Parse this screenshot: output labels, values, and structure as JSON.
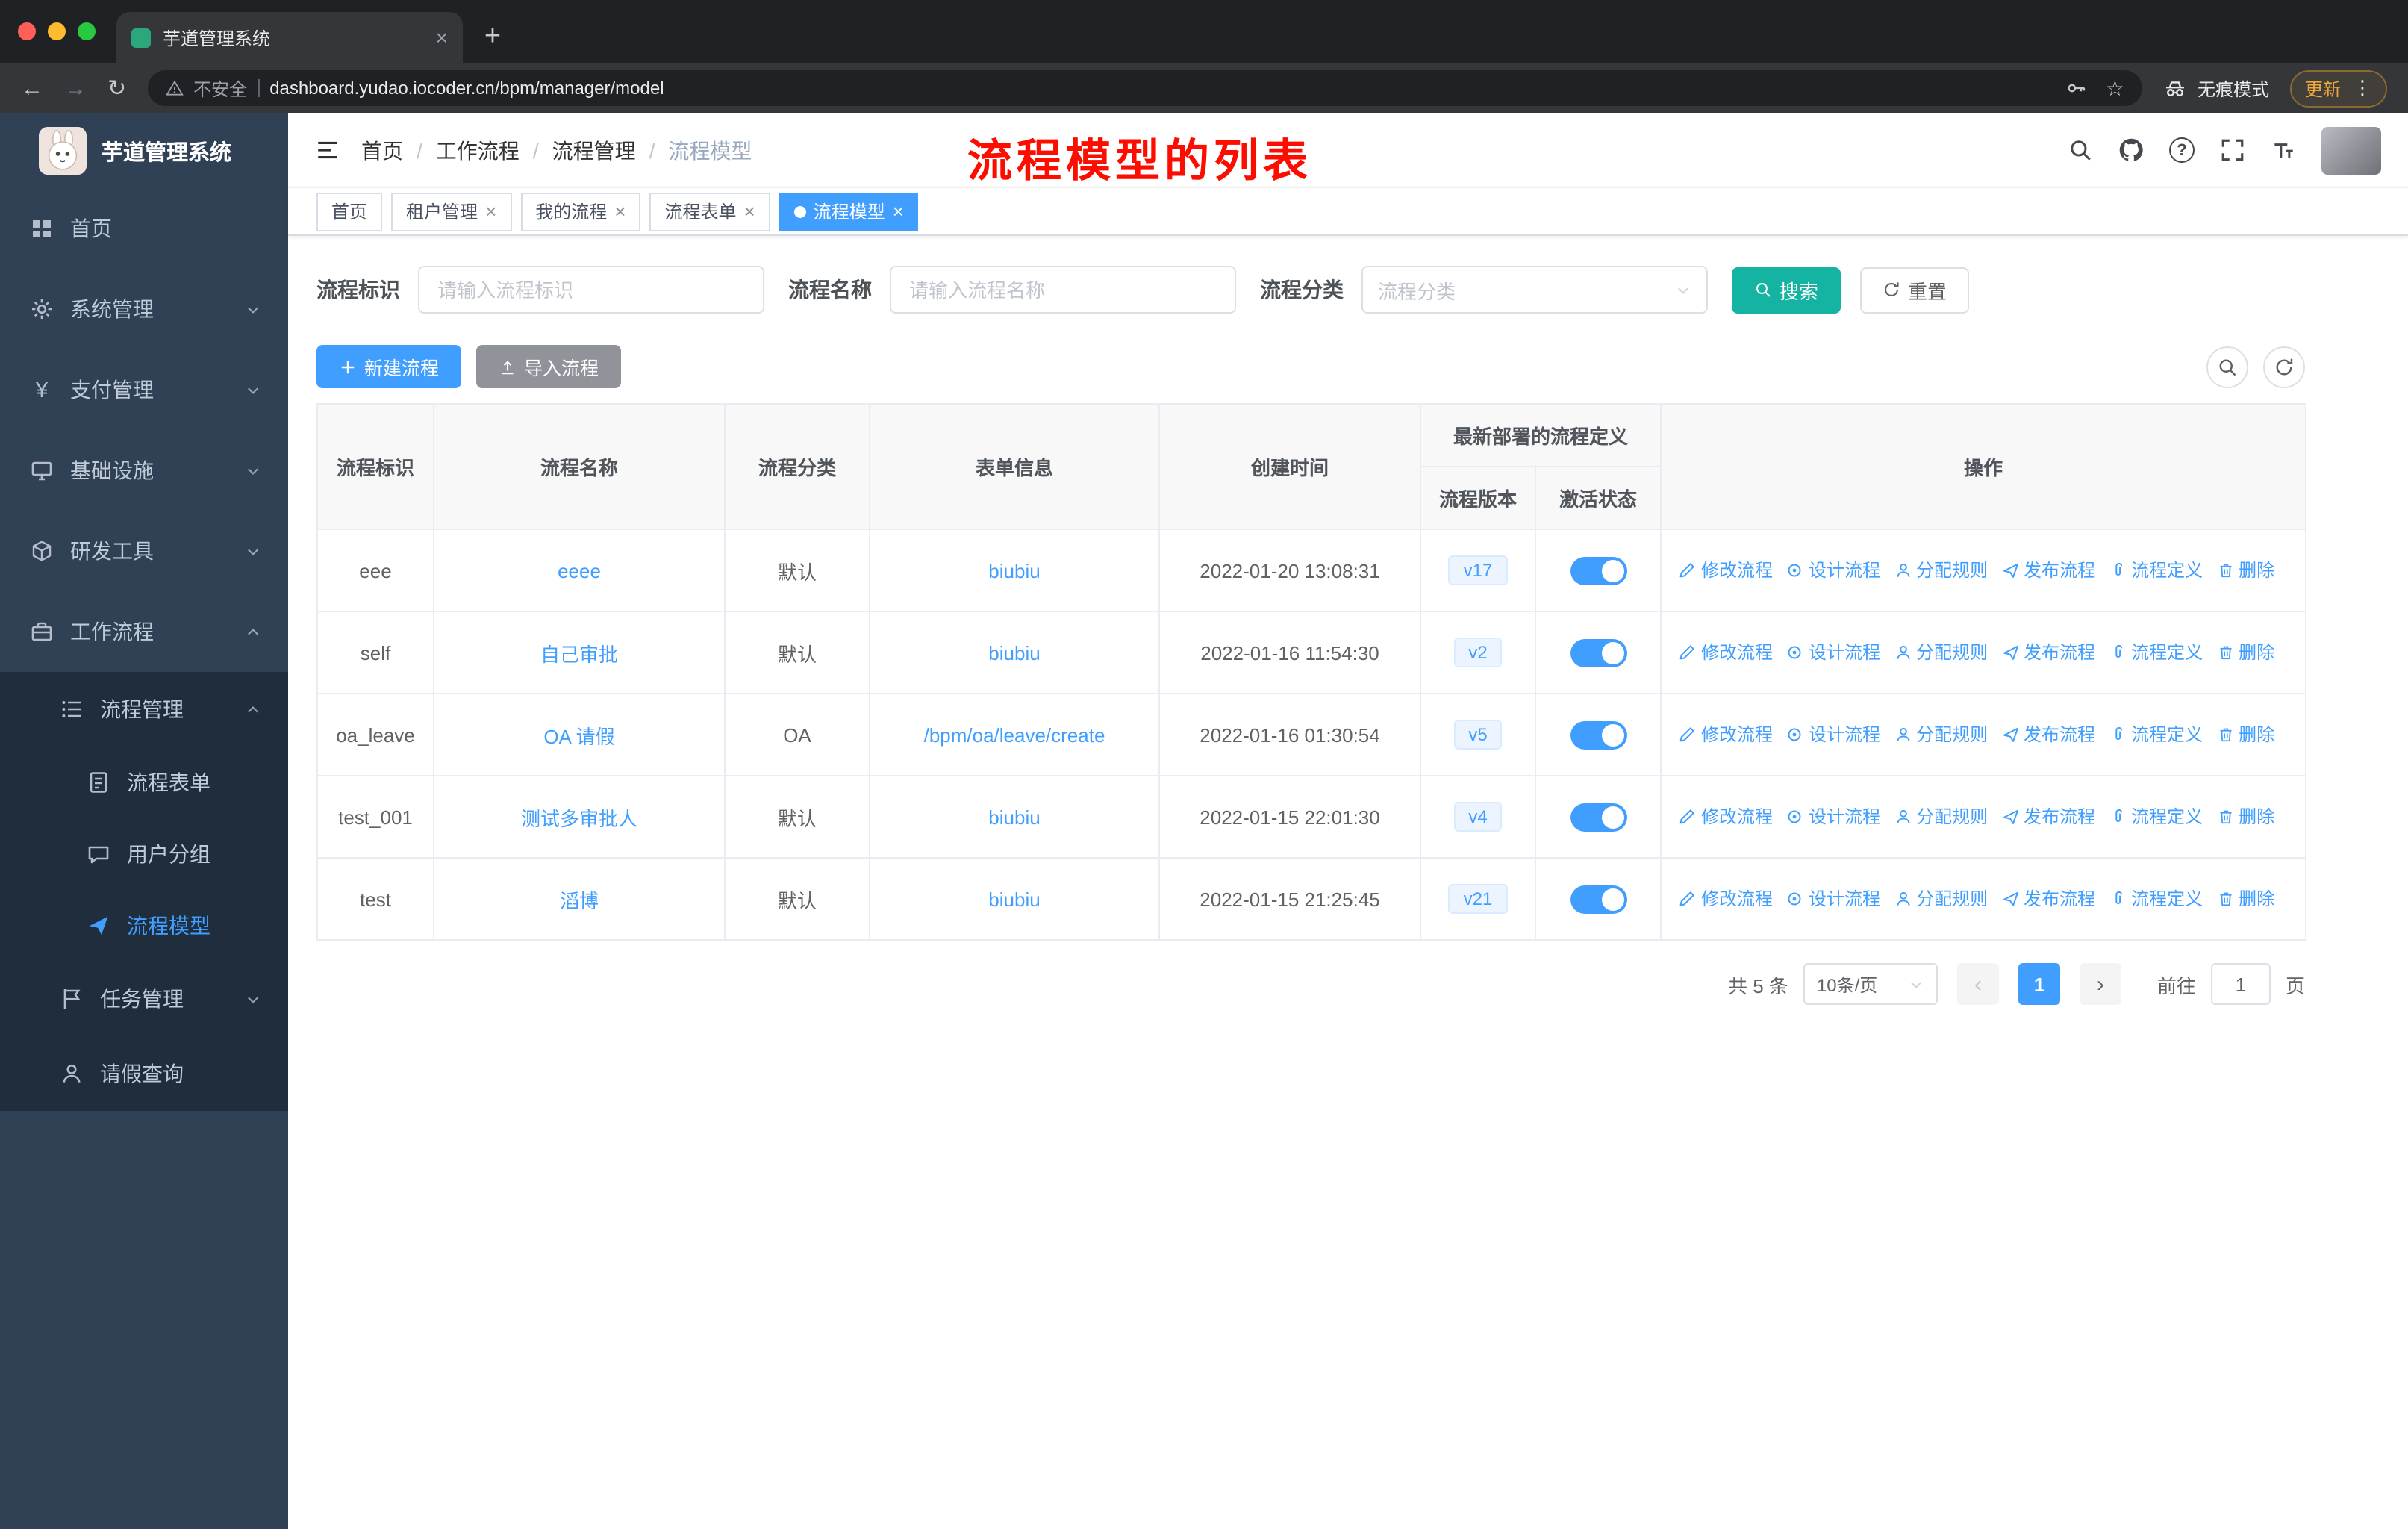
{
  "browser": {
    "tab_title": "芋道管理系统",
    "security_label": "不安全",
    "url": "dashboard.yudao.iocoder.cn/bpm/manager/model",
    "incognito_label": "无痕模式",
    "update_label": "更新"
  },
  "sidebar": {
    "logo_title": "芋道管理系统",
    "items": [
      {
        "label": "首页",
        "icon": "dashboard-icon"
      },
      {
        "label": "系统管理",
        "icon": "gear-icon",
        "chevron": "down"
      },
      {
        "label": "支付管理",
        "icon": "yen-icon",
        "chevron": "down"
      },
      {
        "label": "基础设施",
        "icon": "monitor-icon",
        "chevron": "down"
      },
      {
        "label": "研发工具",
        "icon": "cube-icon",
        "chevron": "down"
      },
      {
        "label": "工作流程",
        "icon": "briefcase-icon",
        "chevron": "up",
        "expanded": true
      }
    ],
    "workflow_children": [
      {
        "label": "流程管理",
        "icon": "list-icon",
        "chevron": "up",
        "expanded": true,
        "children": [
          {
            "label": "流程表单",
            "icon": "document-icon",
            "active": false
          },
          {
            "label": "用户分组",
            "icon": "chat-icon",
            "active": false
          },
          {
            "label": "流程模型",
            "icon": "send-icon",
            "active": true
          }
        ]
      },
      {
        "label": "任务管理",
        "icon": "flag-icon",
        "chevron": "down"
      },
      {
        "label": "请假查询",
        "icon": "user-icon"
      }
    ]
  },
  "header": {
    "breadcrumb": [
      "首页",
      "工作流程",
      "流程管理",
      "流程模型"
    ],
    "annotation": "流程模型的列表"
  },
  "tags": [
    {
      "label": "首页",
      "closable": false,
      "active": false
    },
    {
      "label": "租户管理",
      "closable": true,
      "active": false
    },
    {
      "label": "我的流程",
      "closable": true,
      "active": false
    },
    {
      "label": "流程表单",
      "closable": true,
      "active": false
    },
    {
      "label": "流程模型",
      "closable": true,
      "active": true
    }
  ],
  "filters": {
    "fields": [
      {
        "label": "流程标识",
        "placeholder": "请输入流程标识",
        "type": "input"
      },
      {
        "label": "流程名称",
        "placeholder": "请输入流程名称",
        "type": "input"
      },
      {
        "label": "流程分类",
        "placeholder": "流程分类",
        "type": "select"
      }
    ],
    "search_label": "搜索",
    "reset_label": "重置"
  },
  "toolbar": {
    "create_label": "新建流程",
    "import_label": "导入流程"
  },
  "table": {
    "columns": [
      "流程标识",
      "流程名称",
      "流程分类",
      "表单信息",
      "创建时间",
      "流程版本",
      "激活状态",
      "操作"
    ],
    "group_header": "最新部署的流程定义",
    "actions": [
      {
        "name": "modify-process-action",
        "label": "修改流程",
        "icon": "edit-icon"
      },
      {
        "name": "design-process-action",
        "label": "设计流程",
        "icon": "design-icon"
      },
      {
        "name": "assign-rules-action",
        "label": "分配规则",
        "icon": "user-icon"
      },
      {
        "name": "publish-process-action",
        "label": "发布流程",
        "icon": "publish-icon"
      },
      {
        "name": "process-definition-action",
        "label": "流程定义",
        "icon": "paperclip-icon"
      },
      {
        "name": "delete-action",
        "label": "删除",
        "icon": "trash-icon"
      }
    ],
    "rows": [
      {
        "key": "eee",
        "name": "eeee",
        "category": "默认",
        "form": "biubiu",
        "created": "2022-01-20 13:08:31",
        "version": "v17",
        "active": true
      },
      {
        "key": "self",
        "name": "自己审批",
        "category": "默认",
        "form": "biubiu",
        "created": "2022-01-16 11:54:30",
        "version": "v2",
        "active": true
      },
      {
        "key": "oa_leave",
        "name": "OA 请假",
        "category": "OA",
        "form": "/bpm/oa/leave/create",
        "created": "2022-01-16 01:30:54",
        "version": "v5",
        "active": true
      },
      {
        "key": "test_001",
        "name": "测试多审批人",
        "category": "默认",
        "form": "biubiu",
        "created": "2022-01-15 22:01:30",
        "version": "v4",
        "active": true
      },
      {
        "key": "test",
        "name": "滔博",
        "category": "默认",
        "form": "biubiu",
        "created": "2022-01-15 21:25:45",
        "version": "v21",
        "active": true
      }
    ]
  },
  "pagination": {
    "total_label": "共 5 条",
    "page_size": "10条/页",
    "current_page": "1",
    "goto_label": "前往",
    "goto_value": "1",
    "page_unit": "页"
  },
  "colors": {
    "accent": "#409EFF",
    "sidebar_bg": "#304156",
    "submenu_bg": "#1F2D3D",
    "annotation_red": "#FD0D00",
    "search_button": "#14B3A2",
    "import_button": "#909399",
    "toggle_on": "#409EFF"
  }
}
